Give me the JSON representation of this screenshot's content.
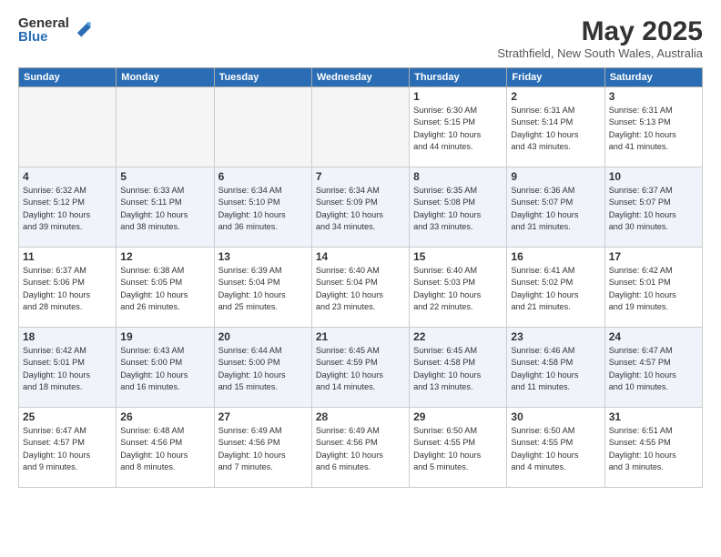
{
  "logo": {
    "general": "General",
    "blue": "Blue"
  },
  "title": "May 2025",
  "subtitle": "Strathfield, New South Wales, Australia",
  "days_header": [
    "Sunday",
    "Monday",
    "Tuesday",
    "Wednesday",
    "Thursday",
    "Friday",
    "Saturday"
  ],
  "weeks": [
    [
      {
        "day": "",
        "detail": ""
      },
      {
        "day": "",
        "detail": ""
      },
      {
        "day": "",
        "detail": ""
      },
      {
        "day": "",
        "detail": ""
      },
      {
        "day": "1",
        "detail": "Sunrise: 6:30 AM\nSunset: 5:15 PM\nDaylight: 10 hours\nand 44 minutes."
      },
      {
        "day": "2",
        "detail": "Sunrise: 6:31 AM\nSunset: 5:14 PM\nDaylight: 10 hours\nand 43 minutes."
      },
      {
        "day": "3",
        "detail": "Sunrise: 6:31 AM\nSunset: 5:13 PM\nDaylight: 10 hours\nand 41 minutes."
      }
    ],
    [
      {
        "day": "4",
        "detail": "Sunrise: 6:32 AM\nSunset: 5:12 PM\nDaylight: 10 hours\nand 39 minutes."
      },
      {
        "day": "5",
        "detail": "Sunrise: 6:33 AM\nSunset: 5:11 PM\nDaylight: 10 hours\nand 38 minutes."
      },
      {
        "day": "6",
        "detail": "Sunrise: 6:34 AM\nSunset: 5:10 PM\nDaylight: 10 hours\nand 36 minutes."
      },
      {
        "day": "7",
        "detail": "Sunrise: 6:34 AM\nSunset: 5:09 PM\nDaylight: 10 hours\nand 34 minutes."
      },
      {
        "day": "8",
        "detail": "Sunrise: 6:35 AM\nSunset: 5:08 PM\nDaylight: 10 hours\nand 33 minutes."
      },
      {
        "day": "9",
        "detail": "Sunrise: 6:36 AM\nSunset: 5:07 PM\nDaylight: 10 hours\nand 31 minutes."
      },
      {
        "day": "10",
        "detail": "Sunrise: 6:37 AM\nSunset: 5:07 PM\nDaylight: 10 hours\nand 30 minutes."
      }
    ],
    [
      {
        "day": "11",
        "detail": "Sunrise: 6:37 AM\nSunset: 5:06 PM\nDaylight: 10 hours\nand 28 minutes."
      },
      {
        "day": "12",
        "detail": "Sunrise: 6:38 AM\nSunset: 5:05 PM\nDaylight: 10 hours\nand 26 minutes."
      },
      {
        "day": "13",
        "detail": "Sunrise: 6:39 AM\nSunset: 5:04 PM\nDaylight: 10 hours\nand 25 minutes."
      },
      {
        "day": "14",
        "detail": "Sunrise: 6:40 AM\nSunset: 5:04 PM\nDaylight: 10 hours\nand 23 minutes."
      },
      {
        "day": "15",
        "detail": "Sunrise: 6:40 AM\nSunset: 5:03 PM\nDaylight: 10 hours\nand 22 minutes."
      },
      {
        "day": "16",
        "detail": "Sunrise: 6:41 AM\nSunset: 5:02 PM\nDaylight: 10 hours\nand 21 minutes."
      },
      {
        "day": "17",
        "detail": "Sunrise: 6:42 AM\nSunset: 5:01 PM\nDaylight: 10 hours\nand 19 minutes."
      }
    ],
    [
      {
        "day": "18",
        "detail": "Sunrise: 6:42 AM\nSunset: 5:01 PM\nDaylight: 10 hours\nand 18 minutes."
      },
      {
        "day": "19",
        "detail": "Sunrise: 6:43 AM\nSunset: 5:00 PM\nDaylight: 10 hours\nand 16 minutes."
      },
      {
        "day": "20",
        "detail": "Sunrise: 6:44 AM\nSunset: 5:00 PM\nDaylight: 10 hours\nand 15 minutes."
      },
      {
        "day": "21",
        "detail": "Sunrise: 6:45 AM\nSunset: 4:59 PM\nDaylight: 10 hours\nand 14 minutes."
      },
      {
        "day": "22",
        "detail": "Sunrise: 6:45 AM\nSunset: 4:58 PM\nDaylight: 10 hours\nand 13 minutes."
      },
      {
        "day": "23",
        "detail": "Sunrise: 6:46 AM\nSunset: 4:58 PM\nDaylight: 10 hours\nand 11 minutes."
      },
      {
        "day": "24",
        "detail": "Sunrise: 6:47 AM\nSunset: 4:57 PM\nDaylight: 10 hours\nand 10 minutes."
      }
    ],
    [
      {
        "day": "25",
        "detail": "Sunrise: 6:47 AM\nSunset: 4:57 PM\nDaylight: 10 hours\nand 9 minutes."
      },
      {
        "day": "26",
        "detail": "Sunrise: 6:48 AM\nSunset: 4:56 PM\nDaylight: 10 hours\nand 8 minutes."
      },
      {
        "day": "27",
        "detail": "Sunrise: 6:49 AM\nSunset: 4:56 PM\nDaylight: 10 hours\nand 7 minutes."
      },
      {
        "day": "28",
        "detail": "Sunrise: 6:49 AM\nSunset: 4:56 PM\nDaylight: 10 hours\nand 6 minutes."
      },
      {
        "day": "29",
        "detail": "Sunrise: 6:50 AM\nSunset: 4:55 PM\nDaylight: 10 hours\nand 5 minutes."
      },
      {
        "day": "30",
        "detail": "Sunrise: 6:50 AM\nSunset: 4:55 PM\nDaylight: 10 hours\nand 4 minutes."
      },
      {
        "day": "31",
        "detail": "Sunrise: 6:51 AM\nSunset: 4:55 PM\nDaylight: 10 hours\nand 3 minutes."
      }
    ]
  ]
}
